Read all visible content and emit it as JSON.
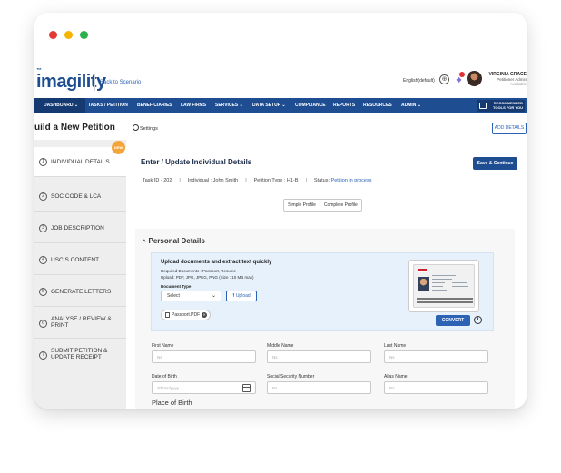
{
  "window": {
    "dot_colors": [
      "#e53935",
      "#f5b400",
      "#2cb14a"
    ]
  },
  "header": {
    "logo_text": "imagility",
    "logo_mark": "™",
    "back_link": "Back to Scenario",
    "language": "English(default)",
    "user_name": "VIRGINIA GRACE",
    "user_role": "Petitioner Admin",
    "user_status": "Available"
  },
  "nav": {
    "items": [
      "DASHBOARD  ⌄",
      "TASKS / PETITION",
      "BENEFICIARIES",
      "LAW FIRMS",
      "SERVICES  ⌄",
      "DATA SETUP  ⌄",
      "COMPLIANCE",
      "REPORTS",
      "RESOURCES",
      "ADMIN  ⌄"
    ],
    "recommended_line1": "RECOMMENDED",
    "recommended_line2": "TOOLS FOR YOU"
  },
  "page": {
    "title": "uild a New Petition",
    "settings": "Settings",
    "add_details": "ADD DETAILS"
  },
  "sidebar": {
    "new_badge": "NEW",
    "steps": [
      {
        "num": "1",
        "label": "INDIVIDUAL DETAILS"
      },
      {
        "num": "2",
        "label": "SOC CODE & LCA"
      },
      {
        "num": "3",
        "label": "JOB DESCRIPTION"
      },
      {
        "num": "4",
        "label": "USCIS CONTENT"
      },
      {
        "num": "5",
        "label": "GENERATE LETTERS"
      },
      {
        "num": "6",
        "label": "ANALYSE / REVIEW &",
        "label2": "PRINT"
      },
      {
        "num": "7",
        "label": "SUBMIT PETITION &",
        "label2": "UPDATE RECEIPT"
      }
    ]
  },
  "main": {
    "section_title": "Enter / Update Individual Details",
    "save_button": "Save & Continue",
    "task_id": "Task ID - 202",
    "individual": "Individual : John Smith",
    "petition_type": "Petition Type : H1-B",
    "status_label": "Status:",
    "status_value": "Petition in process",
    "profile_simple": "Simple Profile",
    "profile_complete": "Complete Profile"
  },
  "personal": {
    "title": "Personal Details",
    "chevron": "^",
    "upload_title": "Upload documents and extract text quickly",
    "required_docs": "Required Documents : Passport, Resume",
    "upload_formats": "Upload: PDF, JPG, JPEG, PNG (Size : 10 MB max)",
    "doc_type_label": "Document Type",
    "doc_type_value": "Select",
    "upload_button": "Upload",
    "file_name": "Passport.PDF",
    "convert_button": "CONVERT",
    "info": "i"
  },
  "form": {
    "first_name_label": "First Name",
    "first_name_ph": "Ns",
    "middle_name_label": "Middle Name",
    "middle_name_ph": "Ns",
    "last_name_label": "Last Name",
    "last_name_ph": "Ns",
    "dob_label": "Date of Birth",
    "dob_ph": "dd/mm/yyyy",
    "ssn_label": "Social Security Number",
    "ssn_ph": "Ns",
    "alias_label": "Alias Name",
    "alias_ph": "Ns",
    "place_of_birth": "Place of Birth"
  }
}
